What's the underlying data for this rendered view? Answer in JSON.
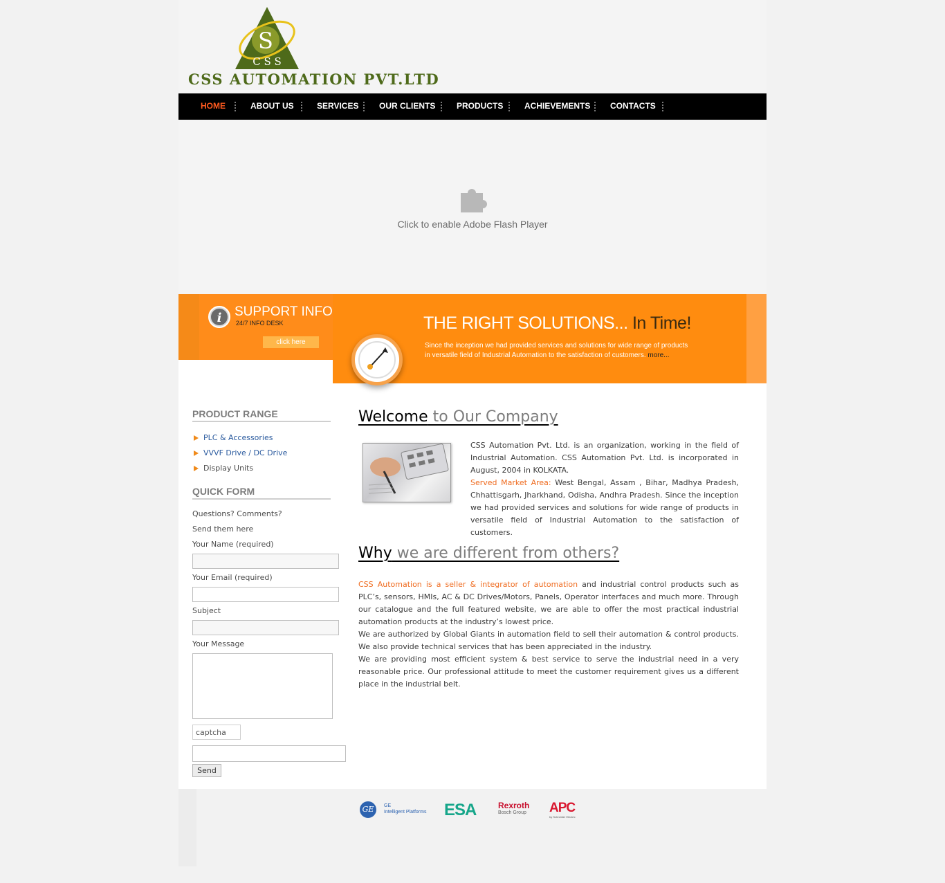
{
  "brand": {
    "name": "CSS AUTOMATION PVT.LTD",
    "logo_letters": "S",
    "logo_bottom": "C S S",
    "colors": {
      "green": "#4e6a1a",
      "orange": "#ff8c0f",
      "accent": "#ef6b1f"
    }
  },
  "nav": {
    "items": [
      {
        "label": "HOME",
        "active": true
      },
      {
        "label": "ABOUT US"
      },
      {
        "label": "SERVICES"
      },
      {
        "label": "OUR CLIENTS"
      },
      {
        "label": "PRODUCTS"
      },
      {
        "label": "ACHIEVEMENTS"
      },
      {
        "label": "CONTACTS"
      }
    ]
  },
  "flash": {
    "icon": "puzzle-icon",
    "message": "Click to enable Adobe Flash Player"
  },
  "support": {
    "icon": "info-icon",
    "title": "SUPPORT INFO",
    "subtitle": "24/7 INFO DESK",
    "button": "click here"
  },
  "solutions": {
    "title_light": "THE RIGHT SOLUTIONS...",
    "title_dark": " In Time!",
    "text": "Since the inception we had provided services and solutions for wide range of products in versatile field of Industrial Automation to the satisfaction of customers.",
    "more": "more..."
  },
  "sidebar": {
    "product_range_heading": "PRODUCT RANGE",
    "products": [
      {
        "label": "PLC & Accessories",
        "link": true
      },
      {
        "label_a": "VVVF Drive",
        "sep": " / ",
        "label_b": "DC Drive",
        "link": true
      },
      {
        "label": "Display Units",
        "link": false
      }
    ],
    "quick_form_heading": "QUICK FORM",
    "quick_form_line1": "Questions? Comments?",
    "quick_form_line2": "Send them here",
    "name_label": "Your Name (required)",
    "email_label": "Your Email (required)",
    "subject_label": "Subject",
    "message_label": "Your Message",
    "captcha_alt": "captcha",
    "send_label": "Send"
  },
  "main": {
    "welcome_bold": "Welcome",
    "welcome_grey": " to Our Company",
    "welcome_p1": "CSS Automation Pvt. Ltd. is an organization, working in the field of Industrial Automation. CSS Automation Pvt. Ltd. is incorporated in August, 2004 in KOLKATA.",
    "served_label": "Served Market Area:",
    "served_text": " West Bengal, Assam , Bihar, Madhya Pradesh, Chhattisgarh, Jharkhand, Odisha, Andhra Pradesh. Since the inception we had provided services and solutions for wide range of products in versatile field of Industrial Automation to the satisfaction of customers.",
    "why_bold": "Why",
    "why_grey": " we are different from others?",
    "why_orange": "CSS Automation is a seller & integrator of automation",
    "why_p1": " and industrial control products such as PLC’s, sensors, HMIs, AC & DC Drives/Motors, Panels, Operator interfaces and much more. Through our catalogue and the full featured website, we are able to offer the most practical industrial automation products at the industry’s lowest price.",
    "why_p2": "We are authorized by Global Giants in automation field to sell their automation & control products. We also provide technical services that has been appreciated in the industry.",
    "why_p3": "We are providing most efficient system & best service to serve the industrial need in a very reasonable price. Our professional attitude to meet the customer requirement gives us a different place in the industrial belt."
  },
  "footer": {
    "ge_mark": "GE",
    "ge_line1": "GE",
    "ge_line2": "Intelligent Platforms",
    "esa": "ESA",
    "rexroth": "Rexroth",
    "rexroth_sub": "Bosch Group",
    "apc": "APC",
    "apc_sub": "by Schneider Electric"
  }
}
